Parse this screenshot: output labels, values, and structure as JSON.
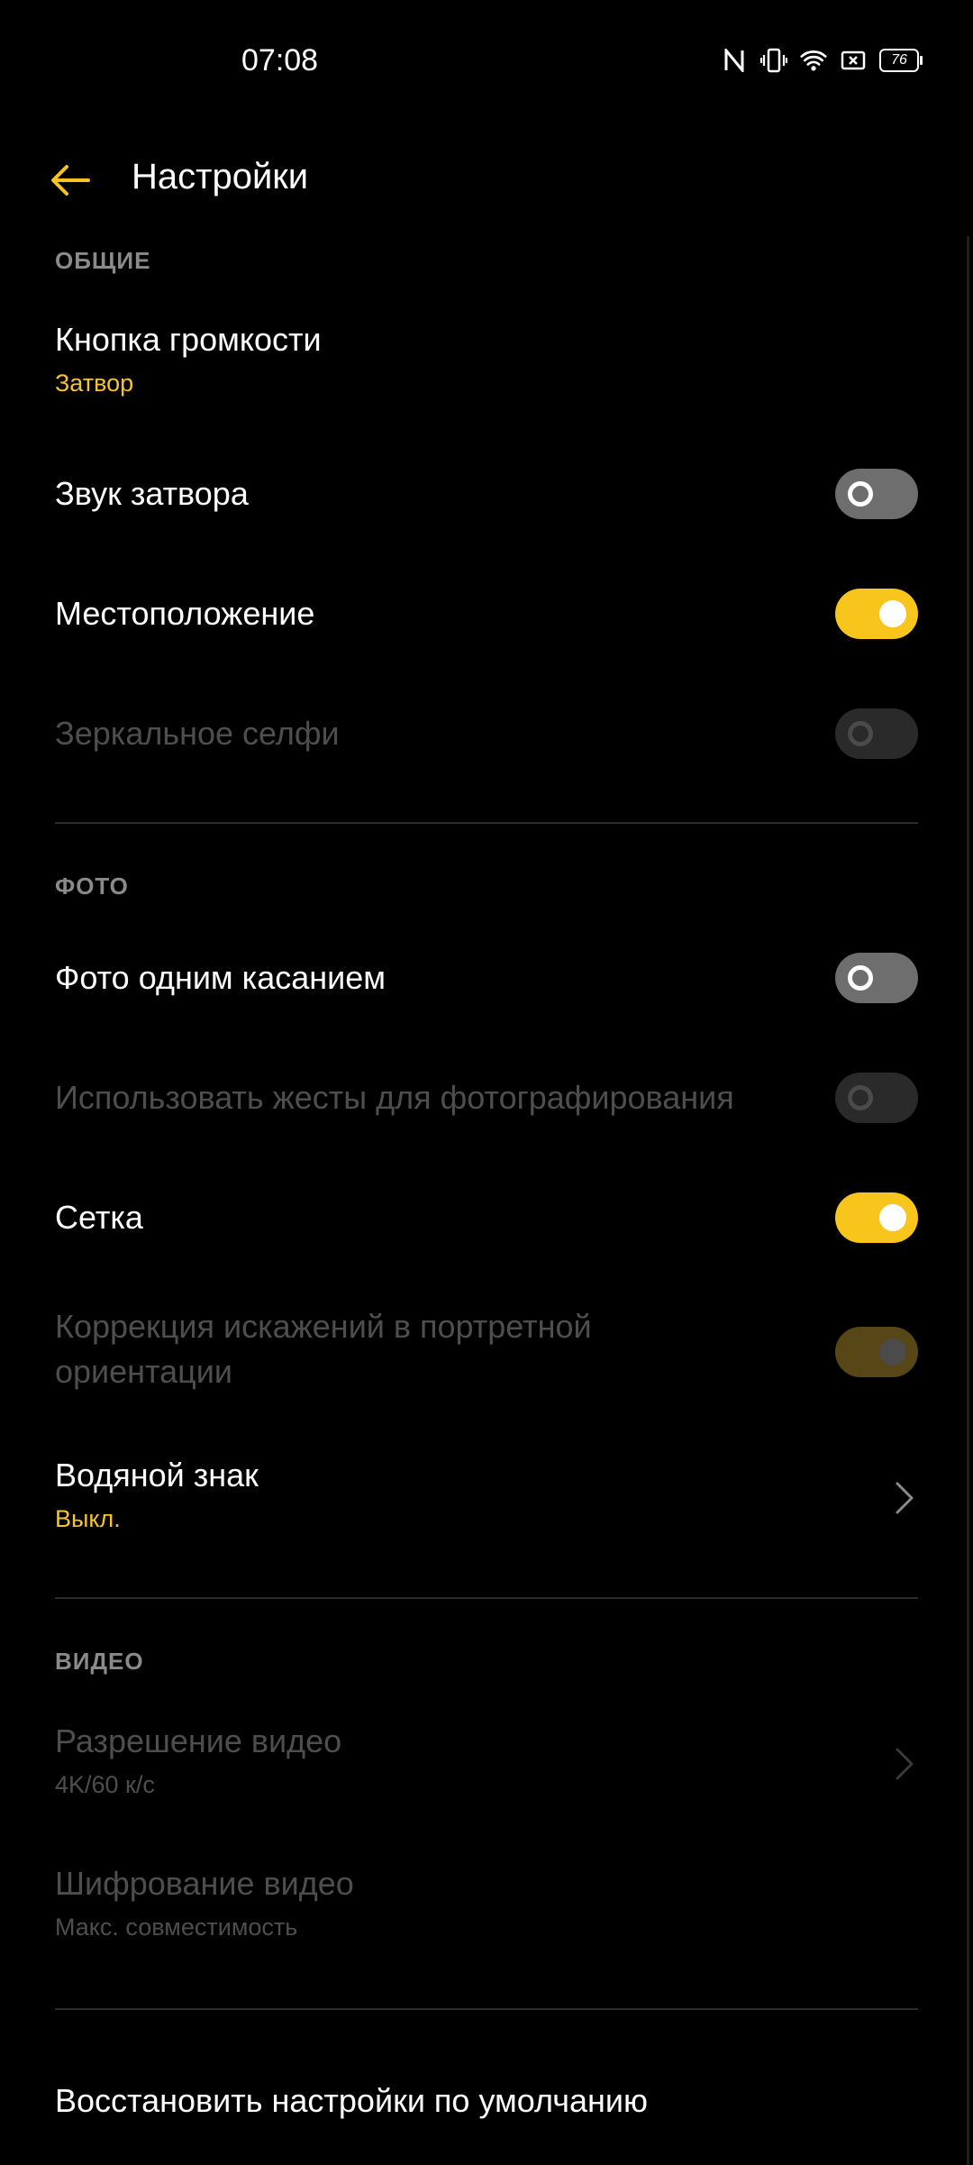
{
  "status_bar": {
    "time": "07:08",
    "icons": [
      "nfc-icon",
      "vibrate-icon",
      "wifi-icon",
      "screen-record-icon",
      "battery-icon"
    ],
    "battery_level": "76"
  },
  "app_bar": {
    "back_icon": "arrow-left-icon",
    "title": "Настройки"
  },
  "colors": {
    "accent": "#f8c51d",
    "background": "#000000",
    "section_header": "#8a8a8a",
    "disabled_text": "#4e4e4e"
  },
  "sections": {
    "general": {
      "header": "ОБЩИЕ",
      "volume_button": {
        "title": "Кнопка громкости",
        "value": "Затвор"
      },
      "shutter_sound": {
        "title": "Звук затвора",
        "toggle": "off"
      },
      "location": {
        "title": "Местоположение",
        "toggle": "on"
      },
      "mirror_selfie": {
        "title": "Зеркальное селфи",
        "toggle": "off",
        "enabled": false
      }
    },
    "photo": {
      "header": "ФОТО",
      "one_touch_photo": {
        "title": "Фото одним касанием",
        "toggle": "off"
      },
      "gestures": {
        "title": "Использовать жесты для фотографирования",
        "toggle": "off",
        "enabled": false
      },
      "grid": {
        "title": "Сетка",
        "toggle": "on"
      },
      "distortion_correction": {
        "title_line1": "Коррекция искажений в портретной",
        "title_line2": "ориентации",
        "toggle": "on",
        "enabled": false
      },
      "watermark": {
        "title": "Водяной знак",
        "value": "Выкл."
      }
    },
    "video": {
      "header": "ВИДЕО",
      "resolution": {
        "title": "Разрешение видео",
        "value": "4K/60 к/с",
        "enabled": false
      },
      "encoding": {
        "title": "Шифрование видео",
        "value": "Макс. совместимость",
        "enabled": false
      }
    },
    "reset": {
      "title": "Восстановить настройки по умолчанию"
    }
  }
}
